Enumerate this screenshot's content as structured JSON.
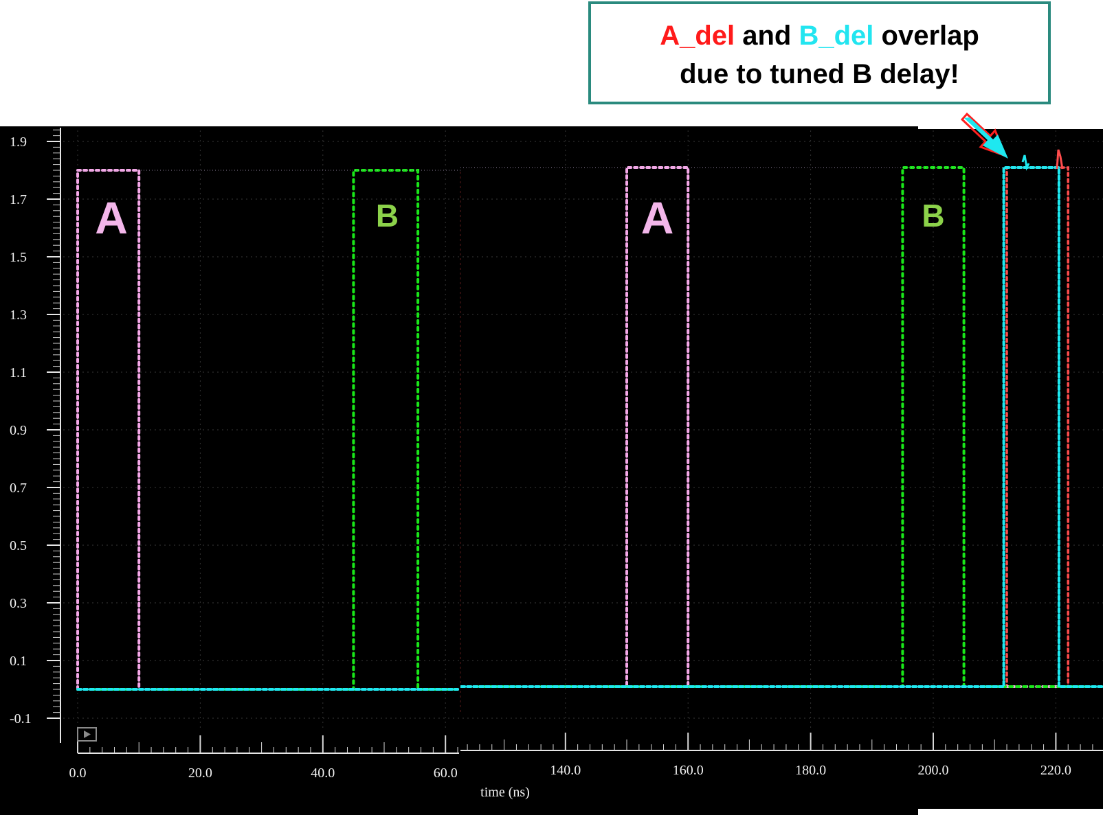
{
  "callout": {
    "part1": "A_del",
    "part2": " and ",
    "part3": "B_del",
    "part4": " overlap",
    "line2": "due to tuned B delay!"
  },
  "colors": {
    "A": "#f5a8e8",
    "B": "#19e619",
    "A_del": "#ff4c4c",
    "B_del": "#1ee8f0",
    "background": "#000000",
    "callout_border": "#2a8a7e",
    "callout_arrow": "#1ee8f0",
    "label_A": "#f3b6ea",
    "label_B": "#8cd24a"
  },
  "chart_data": {
    "type": "line",
    "xlabel": "time (ns)",
    "ylabel": "",
    "ylim": [
      -0.1,
      1.9
    ],
    "yticks": [
      "1.9",
      "1.7",
      "1.5",
      "1.3",
      "1.1",
      "0.9",
      "0.7",
      "0.5",
      "0.3",
      "0.1",
      "-0.1"
    ],
    "xticks_left": [
      "0.0",
      "20.0",
      "40.0",
      "60.0"
    ],
    "xticks_right": [
      "140.0",
      "160.0",
      "180.0",
      "200.0",
      "220.0"
    ],
    "panels": [
      {
        "xlim": [
          0,
          62
        ],
        "series": [
          {
            "key": "A",
            "x": [
              0,
              0,
              10,
              10,
              62
            ],
            "y": [
              0,
              1.8,
              1.8,
              0,
              0
            ]
          },
          {
            "key": "B",
            "x": [
              0,
              45,
              45,
              55.5,
              55.5,
              62
            ],
            "y": [
              0,
              0,
              1.8,
              1.8,
              0,
              0
            ]
          },
          {
            "key": "A_del",
            "x": [
              0,
              62
            ],
            "y": [
              0,
              0
            ]
          },
          {
            "key": "B_del",
            "x": [
              0,
              62
            ],
            "y": [
              0,
              0
            ]
          }
        ],
        "segment_labels": [
          {
            "text": "A",
            "x": 5.5,
            "color_key": "label_A"
          },
          {
            "text": "B",
            "x": 50.5,
            "color_key": "label_B"
          }
        ]
      },
      {
        "xlim": [
          123,
          231
        ],
        "series": [
          {
            "key": "A",
            "x": [
              123,
              150,
              150,
              160,
              160,
              231
            ],
            "y": [
              0,
              0,
              1.8,
              1.8,
              0,
              0
            ]
          },
          {
            "key": "B",
            "x": [
              123,
              195,
              195,
              205,
              205,
              231
            ],
            "y": [
              0,
              0,
              1.8,
              1.8,
              0,
              0
            ]
          },
          {
            "key": "A_del",
            "x": [
              123,
              212,
              212,
              222,
              222,
              231
            ],
            "y": [
              0,
              0,
              1.8,
              1.8,
              0,
              0
            ]
          },
          {
            "key": "B_del",
            "x": [
              123,
              211.5,
              211.5,
              220.5,
              220.5,
              231
            ],
            "y": [
              0,
              0,
              1.8,
              1.8,
              0,
              0
            ]
          }
        ],
        "segment_labels": [
          {
            "text": "A",
            "x": 155,
            "color_key": "label_A"
          },
          {
            "text": "B",
            "x": 200,
            "color_key": "label_B"
          }
        ]
      }
    ]
  }
}
